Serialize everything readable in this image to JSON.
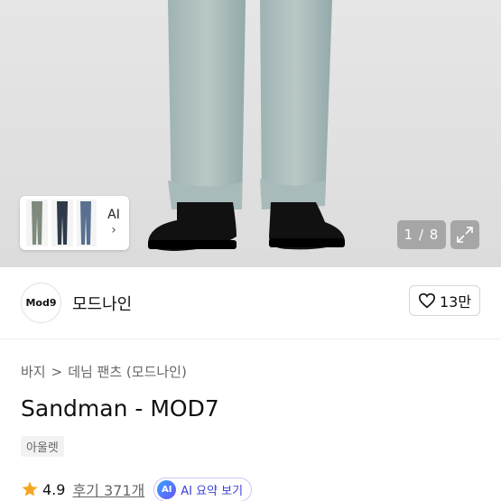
{
  "gallery": {
    "page_current": "1",
    "page_total": "8",
    "page_label": "1 / 8",
    "thumb_ai_label": "AI",
    "thumb_ai_chevron": "›",
    "expand_icon": "expand-icon"
  },
  "brand": {
    "logo_text": "Mod9",
    "name": "모드나인",
    "like_count": "13만",
    "like_icon": "heart-icon"
  },
  "breadcrumb": {
    "category": "바지",
    "separator": ">",
    "subcategory": "데님 팬츠 (모드나인)"
  },
  "product": {
    "title": "Sandman - MOD7",
    "badge": "아울렛"
  },
  "rating": {
    "star_icon": "star-icon",
    "value": "4.9",
    "reviews_label": "후기 371개",
    "ai_badge": "AI",
    "ai_summary_label": "AI 요약 보기"
  },
  "colors": {
    "star": "#f5a623",
    "ai_text": "#3b3fd8",
    "ai_border": "#c9c6f5"
  }
}
